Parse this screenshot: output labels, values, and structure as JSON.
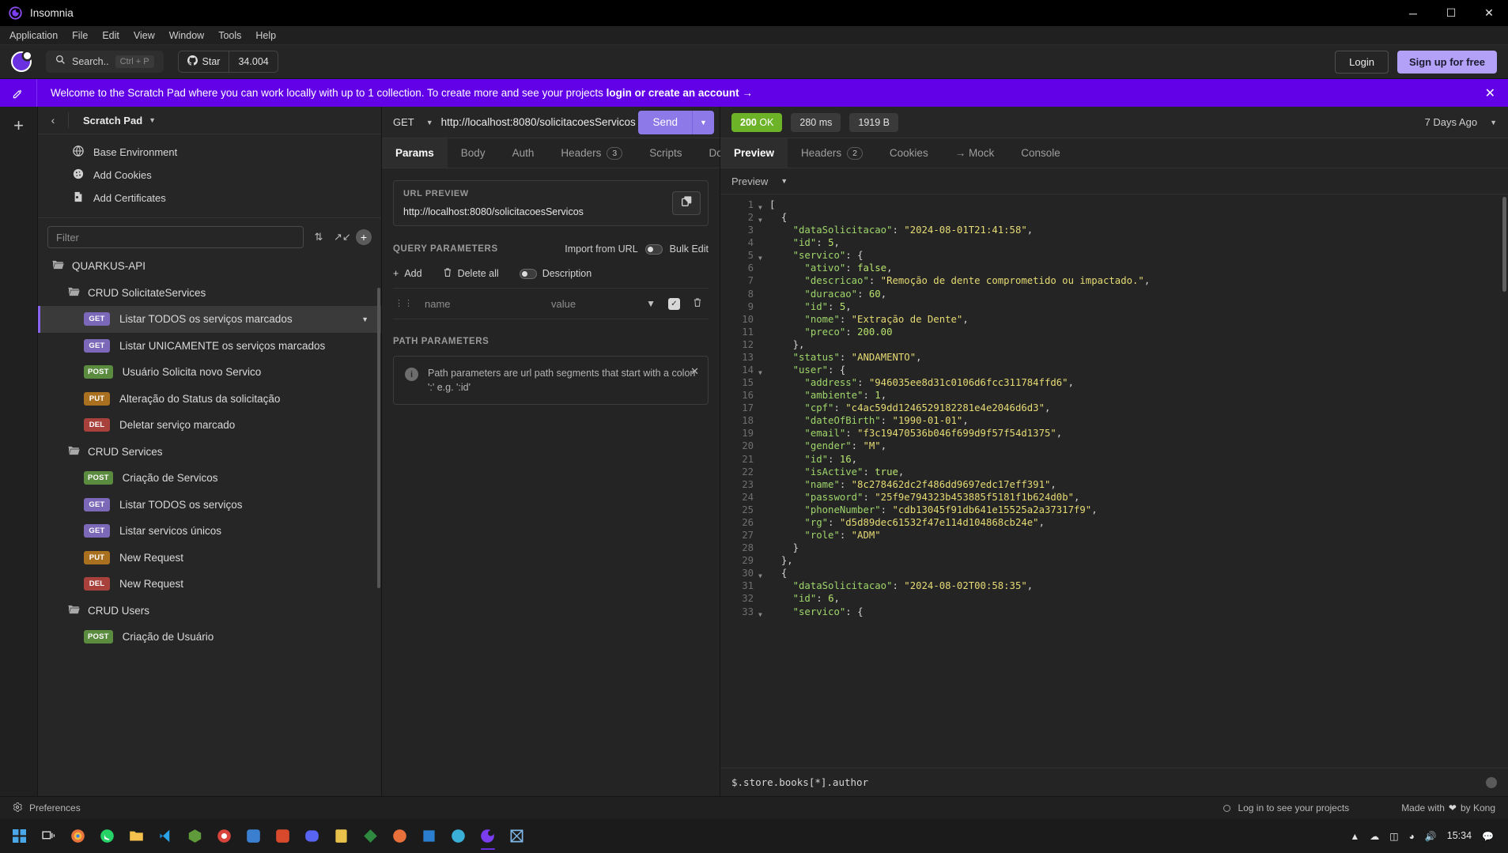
{
  "window": {
    "app_title": "Insomnia",
    "minimize": "─",
    "maximize": "☐",
    "close": "✕"
  },
  "menubar": [
    "Application",
    "File",
    "Edit",
    "View",
    "Window",
    "Tools",
    "Help"
  ],
  "toolbar": {
    "search_label": "Search..",
    "search_shortcut": "Ctrl + P",
    "star_label": "Star",
    "star_count": "34.004",
    "login_label": "Login",
    "signup_label": "Sign up for free"
  },
  "banner": {
    "text_plain": "Welcome to the Scratch Pad where you can work locally with up to 1 collection. To create more and see your projects ",
    "text_bold": "login or create an account →",
    "close": "✕"
  },
  "sidebar": {
    "workspace_name": "Scratch Pad",
    "back": "‹",
    "environments": [
      {
        "label": "Base Environment",
        "icon": "globe-icon"
      },
      {
        "label": "Add Cookies",
        "icon": "cookie-icon"
      },
      {
        "label": "Add Certificates",
        "icon": "certificate-icon"
      }
    ],
    "filter_placeholder": "Filter",
    "tree": [
      {
        "type": "folder",
        "label": "QUARKUS-API",
        "depth": 0
      },
      {
        "type": "folder",
        "label": "CRUD SolicitateServices",
        "depth": 1
      },
      {
        "type": "request",
        "method": "GET",
        "label": "Listar TODOS os serviços marcados",
        "depth": 2,
        "active": true
      },
      {
        "type": "request",
        "method": "GET",
        "label": "Listar UNICAMENTE os serviços marcados",
        "depth": 2
      },
      {
        "type": "request",
        "method": "POST",
        "label": "Usuário Solicita novo Servico",
        "depth": 2
      },
      {
        "type": "request",
        "method": "PUT",
        "label": "Alteração do Status da solicitação",
        "depth": 2
      },
      {
        "type": "request",
        "method": "DEL",
        "label": "Deletar serviço marcado",
        "depth": 2
      },
      {
        "type": "folder",
        "label": "CRUD Services",
        "depth": 1
      },
      {
        "type": "request",
        "method": "POST",
        "label": "Criação de Servicos",
        "depth": 2
      },
      {
        "type": "request",
        "method": "GET",
        "label": "Listar TODOS os serviços",
        "depth": 2
      },
      {
        "type": "request",
        "method": "GET",
        "label": "Listar servicos únicos",
        "depth": 2
      },
      {
        "type": "request",
        "method": "PUT",
        "label": "New Request",
        "depth": 2
      },
      {
        "type": "request",
        "method": "DEL",
        "label": "New Request",
        "depth": 2
      },
      {
        "type": "folder",
        "label": "CRUD Users",
        "depth": 1
      },
      {
        "type": "request",
        "method": "POST",
        "label": "Criação de Usuário",
        "depth": 2
      }
    ]
  },
  "request": {
    "method": "GET",
    "url": "http://localhost:8080/solicitacoesServicos",
    "send_label": "Send",
    "tabs": [
      {
        "label": "Params",
        "active": true
      },
      {
        "label": "Body"
      },
      {
        "label": "Auth"
      },
      {
        "label": "Headers",
        "count": "3"
      },
      {
        "label": "Scripts"
      },
      {
        "label": "Docs"
      }
    ],
    "url_preview_label": "URL PREVIEW",
    "url_preview_value": "http://localhost:8080/solicitacoesServicos",
    "query_params_label": "QUERY PARAMETERS",
    "import_from_url": "Import from URL",
    "bulk_edit": "Bulk Edit",
    "add_label": "Add",
    "delete_all_label": "Delete all",
    "description_label": "Description",
    "param_name_placeholder": "name",
    "param_value_placeholder": "value",
    "path_params_label": "PATH PARAMETERS",
    "path_params_notice": "Path parameters are url path segments that start with a colon ':' e.g. ':id'"
  },
  "response": {
    "status_code": "200",
    "status_text": "OK",
    "time": "280 ms",
    "size": "1919 B",
    "age": "7 Days Ago",
    "tabs": [
      {
        "label": "Preview",
        "active": true
      },
      {
        "label": "Headers",
        "count": "2"
      },
      {
        "label": "Cookies"
      },
      {
        "label": "→ Mock"
      },
      {
        "label": "Console"
      }
    ],
    "preview_mode": "Preview",
    "filter_query": "$.store.books[*].author",
    "body_lines": [
      {
        "n": 1,
        "fold": true,
        "indent": 0,
        "tokens": [
          [
            "p",
            "["
          ]
        ]
      },
      {
        "n": 2,
        "fold": true,
        "indent": 1,
        "tokens": [
          [
            "p",
            "{"
          ]
        ]
      },
      {
        "n": 3,
        "indent": 2,
        "tokens": [
          [
            "k",
            "\"dataSolicitacao\""
          ],
          [
            "p",
            ": "
          ],
          [
            "s",
            "\"2024-08-01T21:41:58\""
          ],
          [
            "p",
            ","
          ]
        ]
      },
      {
        "n": 4,
        "indent": 2,
        "tokens": [
          [
            "k",
            "\"id\""
          ],
          [
            "p",
            ": "
          ],
          [
            "n",
            "5"
          ],
          [
            "p",
            ","
          ]
        ]
      },
      {
        "n": 5,
        "fold": true,
        "indent": 2,
        "tokens": [
          [
            "k",
            "\"servico\""
          ],
          [
            "p",
            ": {"
          ]
        ]
      },
      {
        "n": 6,
        "indent": 3,
        "tokens": [
          [
            "k",
            "\"ativo\""
          ],
          [
            "p",
            ": "
          ],
          [
            "b",
            "false"
          ],
          [
            "p",
            ","
          ]
        ]
      },
      {
        "n": 7,
        "indent": 3,
        "tokens": [
          [
            "k",
            "\"descricao\""
          ],
          [
            "p",
            ": "
          ],
          [
            "s",
            "\"Remoção de dente comprometido ou impactado.\""
          ],
          [
            "p",
            ","
          ]
        ]
      },
      {
        "n": 8,
        "indent": 3,
        "tokens": [
          [
            "k",
            "\"duracao\""
          ],
          [
            "p",
            ": "
          ],
          [
            "n",
            "60"
          ],
          [
            "p",
            ","
          ]
        ]
      },
      {
        "n": 9,
        "indent": 3,
        "tokens": [
          [
            "k",
            "\"id\""
          ],
          [
            "p",
            ": "
          ],
          [
            "n",
            "5"
          ],
          [
            "p",
            ","
          ]
        ]
      },
      {
        "n": 10,
        "indent": 3,
        "tokens": [
          [
            "k",
            "\"nome\""
          ],
          [
            "p",
            ": "
          ],
          [
            "s",
            "\"Extração de Dente\""
          ],
          [
            "p",
            ","
          ]
        ]
      },
      {
        "n": 11,
        "indent": 3,
        "tokens": [
          [
            "k",
            "\"preco\""
          ],
          [
            "p",
            ": "
          ],
          [
            "n",
            "200.00"
          ]
        ]
      },
      {
        "n": 12,
        "indent": 2,
        "tokens": [
          [
            "p",
            "},"
          ]
        ]
      },
      {
        "n": 13,
        "indent": 2,
        "tokens": [
          [
            "k",
            "\"status\""
          ],
          [
            "p",
            ": "
          ],
          [
            "s",
            "\"ANDAMENTO\""
          ],
          [
            "p",
            ","
          ]
        ]
      },
      {
        "n": 14,
        "fold": true,
        "indent": 2,
        "tokens": [
          [
            "k",
            "\"user\""
          ],
          [
            "p",
            ": {"
          ]
        ]
      },
      {
        "n": 15,
        "indent": 3,
        "tokens": [
          [
            "k",
            "\"address\""
          ],
          [
            "p",
            ": "
          ],
          [
            "s",
            "\"946035ee8d31c0106d6fcc311784ffd6\""
          ],
          [
            "p",
            ","
          ]
        ]
      },
      {
        "n": 16,
        "indent": 3,
        "tokens": [
          [
            "k",
            "\"ambiente\""
          ],
          [
            "p",
            ": "
          ],
          [
            "n",
            "1"
          ],
          [
            "p",
            ","
          ]
        ]
      },
      {
        "n": 17,
        "indent": 3,
        "tokens": [
          [
            "k",
            "\"cpf\""
          ],
          [
            "p",
            ": "
          ],
          [
            "s",
            "\"c4ac59dd1246529182281e4e2046d6d3\""
          ],
          [
            "p",
            ","
          ]
        ]
      },
      {
        "n": 18,
        "indent": 3,
        "tokens": [
          [
            "k",
            "\"dateOfBirth\""
          ],
          [
            "p",
            ": "
          ],
          [
            "s",
            "\"1990-01-01\""
          ],
          [
            "p",
            ","
          ]
        ]
      },
      {
        "n": 19,
        "indent": 3,
        "tokens": [
          [
            "k",
            "\"email\""
          ],
          [
            "p",
            ": "
          ],
          [
            "s",
            "\"f3c19470536b046f699d9f57f54d1375\""
          ],
          [
            "p",
            ","
          ]
        ]
      },
      {
        "n": 20,
        "indent": 3,
        "tokens": [
          [
            "k",
            "\"gender\""
          ],
          [
            "p",
            ": "
          ],
          [
            "s",
            "\"M\""
          ],
          [
            "p",
            ","
          ]
        ]
      },
      {
        "n": 21,
        "indent": 3,
        "tokens": [
          [
            "k",
            "\"id\""
          ],
          [
            "p",
            ": "
          ],
          [
            "n",
            "16"
          ],
          [
            "p",
            ","
          ]
        ]
      },
      {
        "n": 22,
        "indent": 3,
        "tokens": [
          [
            "k",
            "\"isActive\""
          ],
          [
            "p",
            ": "
          ],
          [
            "b",
            "true"
          ],
          [
            "p",
            ","
          ]
        ]
      },
      {
        "n": 23,
        "indent": 3,
        "tokens": [
          [
            "k",
            "\"name\""
          ],
          [
            "p",
            ": "
          ],
          [
            "s",
            "\"8c278462dc2f486dd9697edc17eff391\""
          ],
          [
            "p",
            ","
          ]
        ]
      },
      {
        "n": 24,
        "indent": 3,
        "tokens": [
          [
            "k",
            "\"password\""
          ],
          [
            "p",
            ": "
          ],
          [
            "s",
            "\"25f9e794323b453885f5181f1b624d0b\""
          ],
          [
            "p",
            ","
          ]
        ]
      },
      {
        "n": 25,
        "indent": 3,
        "tokens": [
          [
            "k",
            "\"phoneNumber\""
          ],
          [
            "p",
            ": "
          ],
          [
            "s",
            "\"cdb13045f91db641e15525a2a37317f9\""
          ],
          [
            "p",
            ","
          ]
        ]
      },
      {
        "n": 26,
        "indent": 3,
        "tokens": [
          [
            "k",
            "\"rg\""
          ],
          [
            "p",
            ": "
          ],
          [
            "s",
            "\"d5d89dec61532f47e114d104868cb24e\""
          ],
          [
            "p",
            ","
          ]
        ]
      },
      {
        "n": 27,
        "indent": 3,
        "tokens": [
          [
            "k",
            "\"role\""
          ],
          [
            "p",
            ": "
          ],
          [
            "s",
            "\"ADM\""
          ]
        ]
      },
      {
        "n": 28,
        "indent": 2,
        "tokens": [
          [
            "p",
            "}"
          ]
        ]
      },
      {
        "n": 29,
        "indent": 1,
        "tokens": [
          [
            "p",
            "},"
          ]
        ]
      },
      {
        "n": 30,
        "fold": true,
        "indent": 1,
        "tokens": [
          [
            "p",
            "{"
          ]
        ]
      },
      {
        "n": 31,
        "indent": 2,
        "tokens": [
          [
            "k",
            "\"dataSolicitacao\""
          ],
          [
            "p",
            ": "
          ],
          [
            "s",
            "\"2024-08-02T00:58:35\""
          ],
          [
            "p",
            ","
          ]
        ]
      },
      {
        "n": 32,
        "indent": 2,
        "tokens": [
          [
            "k",
            "\"id\""
          ],
          [
            "p",
            ": "
          ],
          [
            "n",
            "6"
          ],
          [
            "p",
            ","
          ]
        ]
      },
      {
        "n": 33,
        "fold": true,
        "indent": 2,
        "tokens": [
          [
            "k",
            "\"servico\""
          ],
          [
            "p",
            ": {"
          ]
        ]
      }
    ]
  },
  "statusbar": {
    "preferences": "Preferences",
    "login_note": "Log in to see your projects",
    "made_with_prefix": "Made with ",
    "made_with_suffix": " by Kong"
  },
  "taskbar": {
    "time": "15:34",
    "date": ""
  },
  "colors": {
    "accent": "#6200e8",
    "send": "#8e79e8",
    "status_ok": "#6cb327",
    "get": "#7b68b8",
    "post": "#5b8b3f",
    "put": "#a8701f",
    "del": "#a8413b"
  }
}
